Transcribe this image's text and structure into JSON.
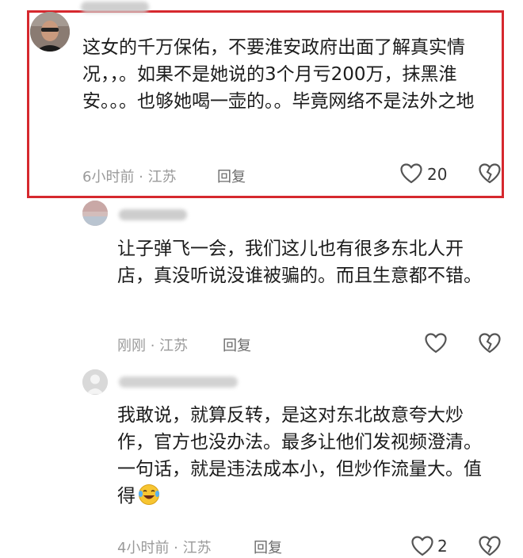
{
  "comments": [
    {
      "text": "这女的千万保佑，不要淮安政府出面了解真实情况，，。如果不是她说的3个月亏200万，抹黑淮安。。。也够她喝一壶的。。毕竟网络不是法外之地",
      "meta": "6小时前 · 江苏",
      "reply_label": "回复",
      "likes": "20",
      "highlighted": true
    },
    {
      "text": "让子弹飞一会，我们这儿也有很多东北人开店，真没听说没谁被骗的。而且生意都不错。",
      "meta": "刚刚 · 江苏",
      "reply_label": "回复",
      "likes": ""
    },
    {
      "text": "我敢说，就算反转，是这对东北故意夸大炒作，官方也没办法。最多让他们发视频澄清。一句话，就是违法成本小，但炒作流量大。值得",
      "meta": "4小时前 · 江苏",
      "reply_label": "回复",
      "likes": "2"
    }
  ],
  "colors": {
    "highlight": "#d6282e",
    "meta": "#9a9a9a",
    "text": "#1c1c1c"
  },
  "icons": [
    "heart-outline-icon",
    "broken-heart-icon",
    "laughing-emoji"
  ]
}
